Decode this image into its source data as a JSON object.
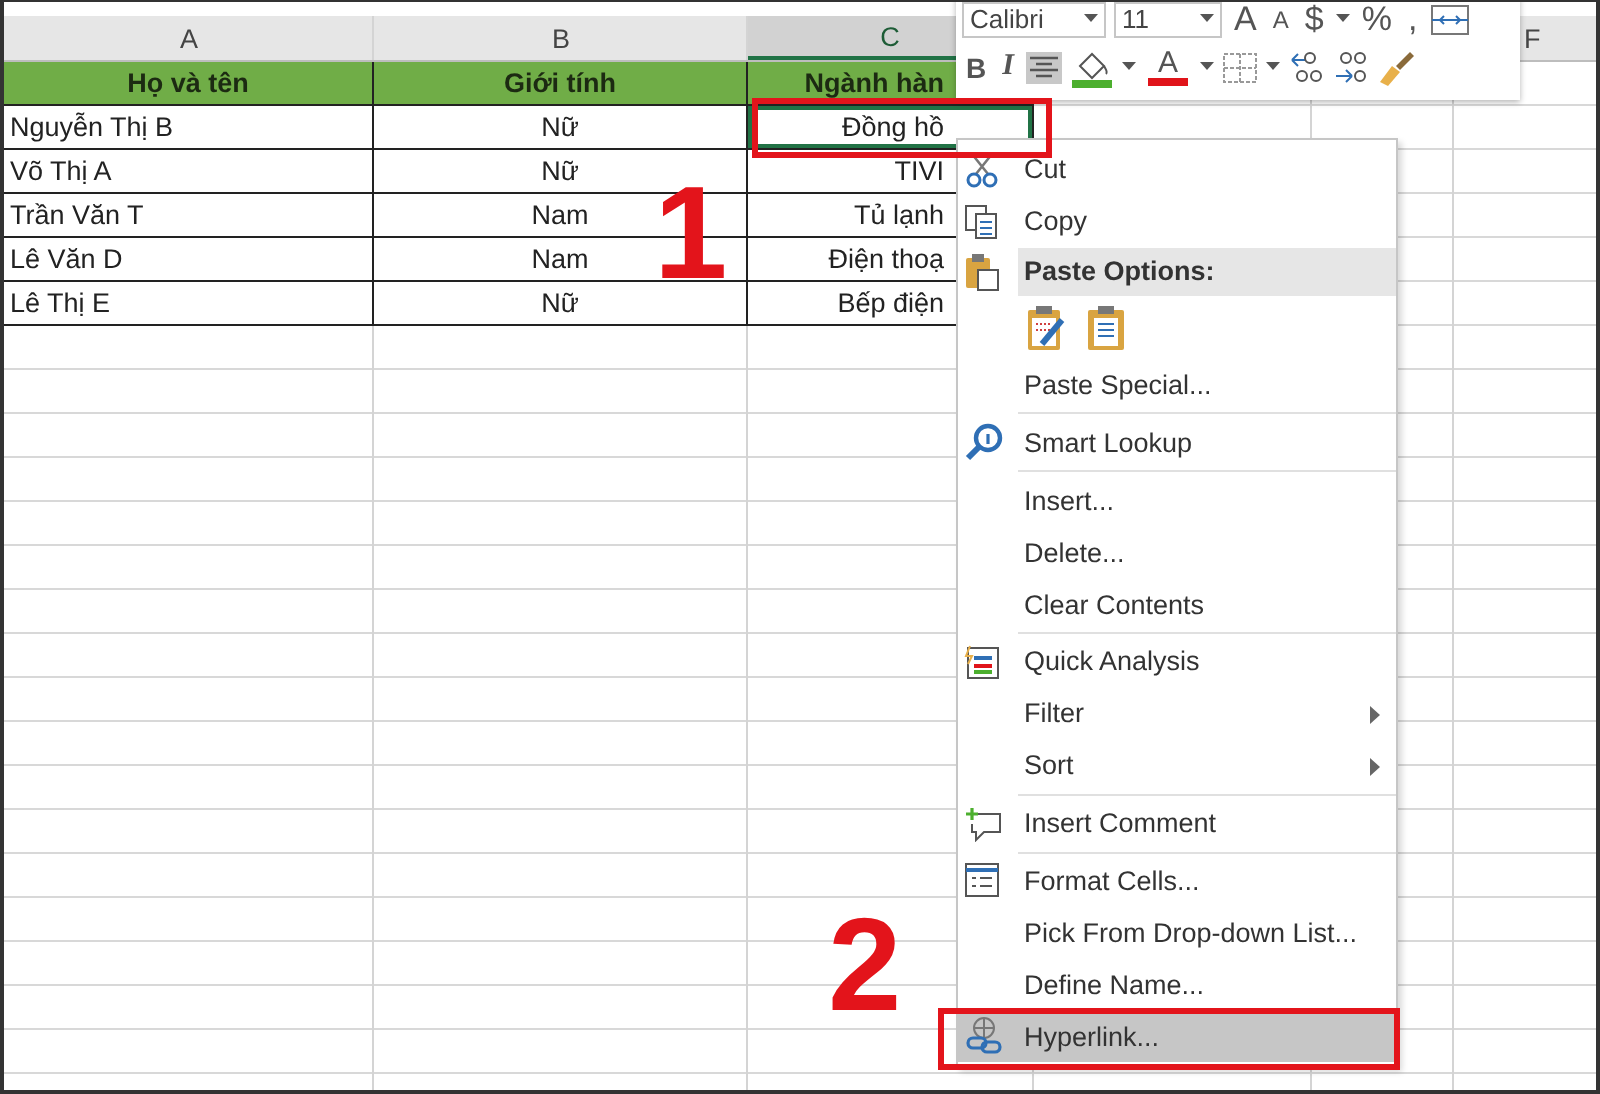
{
  "sheet": {
    "columns": [
      {
        "label": "A",
        "selected": false
      },
      {
        "label": "B",
        "selected": false
      },
      {
        "label": "C",
        "selected": true
      },
      {},
      {},
      {
        "label": "F",
        "selected": false
      }
    ],
    "header_row": [
      "Họ và tên",
      "Giới tính",
      "Ngành hàn"
    ],
    "rows": [
      {
        "cells": [
          "Nguyễn Thị B",
          "Nữ",
          "Đồng hồ"
        ],
        "selected": true
      },
      {
        "cells": [
          "Võ Thị A",
          "Nữ",
          "TIVI"
        ],
        "selected": false
      },
      {
        "cells": [
          "Trần Văn T",
          "Nam",
          "Tủ lạnh"
        ],
        "selected": false
      },
      {
        "cells": [
          "Lê Văn D",
          "Nam",
          "Điện thoạ"
        ],
        "selected": false
      },
      {
        "cells": [
          "Lê Thị E",
          "Nữ",
          "Bếp điện"
        ],
        "selected": false
      }
    ]
  },
  "mini_toolbar": {
    "font": "Calibri",
    "size": "11",
    "row_1": [
      {
        "kind": "grow-font",
        "label": "A"
      },
      {
        "kind": "shrink-font",
        "label": "A"
      },
      {
        "kind": "text",
        "label": "$"
      },
      {
        "kind": "caret"
      },
      {
        "kind": "text",
        "label": "%"
      },
      {
        "kind": "text",
        "label": ","
      },
      {
        "kind": "wrap-text"
      }
    ],
    "row_2": [
      {
        "kind": "bold",
        "label": "B"
      },
      {
        "kind": "italic",
        "label": "I"
      },
      {
        "kind": "align-center",
        "on": true
      },
      {
        "kind": "fill-color"
      },
      {
        "kind": "caret"
      },
      {
        "kind": "font-color",
        "label": "A"
      },
      {
        "kind": "caret"
      },
      {
        "kind": "borders"
      },
      {
        "kind": "caret"
      },
      {
        "kind": "increase-decimal"
      },
      {
        "kind": "decrease-decimal"
      },
      {
        "kind": "format-painter"
      }
    ]
  },
  "context_menu": [
    {
      "kind": "item",
      "label": "Cut",
      "highlighted": false
    },
    {
      "kind": "item",
      "label": "Copy",
      "highlighted": false
    },
    {
      "kind": "header",
      "label": "Paste Options:"
    },
    {
      "kind": "paste-icons"
    },
    {
      "kind": "item",
      "label": "Paste Special...",
      "highlighted": false
    },
    {
      "kind": "separator"
    },
    {
      "kind": "item",
      "label": "Smart Lookup",
      "highlighted": false
    },
    {
      "kind": "separator"
    },
    {
      "kind": "item",
      "label": "Insert...",
      "highlighted": false
    },
    {
      "kind": "item",
      "label": "Delete...",
      "highlighted": false
    },
    {
      "kind": "item",
      "label": "Clear Contents",
      "highlighted": false
    },
    {
      "kind": "separator"
    },
    {
      "kind": "item",
      "label": "Quick Analysis",
      "highlighted": false
    },
    {
      "kind": "item",
      "label": "Filter",
      "submenu": true,
      "highlighted": false
    },
    {
      "kind": "item",
      "label": "Sort",
      "submenu": true,
      "highlighted": false
    },
    {
      "kind": "separator"
    },
    {
      "kind": "item",
      "label": "Insert Comment",
      "highlighted": false
    },
    {
      "kind": "separator"
    },
    {
      "kind": "item",
      "label": "Format Cells...",
      "highlighted": false
    },
    {
      "kind": "item",
      "label": "Pick From Drop-down List...",
      "highlighted": false
    },
    {
      "kind": "item",
      "label": "Define Name...",
      "highlighted": false
    },
    {
      "kind": "item",
      "label": "Hyperlink...",
      "highlighted": true
    }
  ],
  "annotations": [
    {
      "label": "1"
    },
    {
      "label": "2"
    }
  ]
}
